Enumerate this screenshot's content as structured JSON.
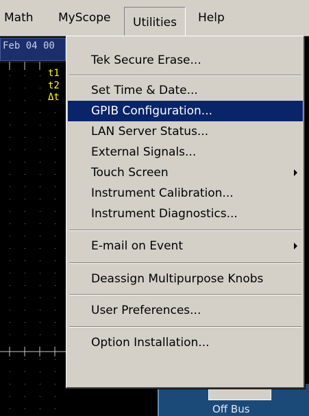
{
  "menubar": {
    "items": [
      {
        "label": "Math"
      },
      {
        "label": "MyScope"
      },
      {
        "label": "Utilities"
      },
      {
        "label": "Help"
      }
    ]
  },
  "scope": {
    "date_text": "Feb 04 00",
    "cursor_labels": [
      "t1",
      "t2",
      "Δt"
    ],
    "colors": {
      "cursor": "#ffff00",
      "grid": "#808080",
      "date_bar": "#1c2f6b"
    }
  },
  "panel": {
    "label": "Off Bus"
  },
  "dropdown": {
    "selected_color": "#0a246a",
    "items": [
      {
        "label": "Tek Secure Erase...",
        "submenu": false,
        "selected": false
      },
      {
        "label": "Set Time & Date...",
        "submenu": false,
        "selected": false
      },
      {
        "label": "GPIB Configuration...",
        "submenu": false,
        "selected": true
      },
      {
        "label": "LAN Server Status...",
        "submenu": false,
        "selected": false
      },
      {
        "label": "External Signals...",
        "submenu": false,
        "selected": false
      },
      {
        "label": "Touch Screen",
        "submenu": true,
        "selected": false
      },
      {
        "label": "Instrument Calibration...",
        "submenu": false,
        "selected": false
      },
      {
        "label": "Instrument Diagnostics...",
        "submenu": false,
        "selected": false
      },
      {
        "label": "E-mail on Event",
        "submenu": true,
        "selected": false
      },
      {
        "label": "Deassign Multipurpose Knobs",
        "submenu": false,
        "selected": false
      },
      {
        "label": "User Preferences...",
        "submenu": false,
        "selected": false
      },
      {
        "label": "Option Installation...",
        "submenu": false,
        "selected": false
      }
    ]
  }
}
